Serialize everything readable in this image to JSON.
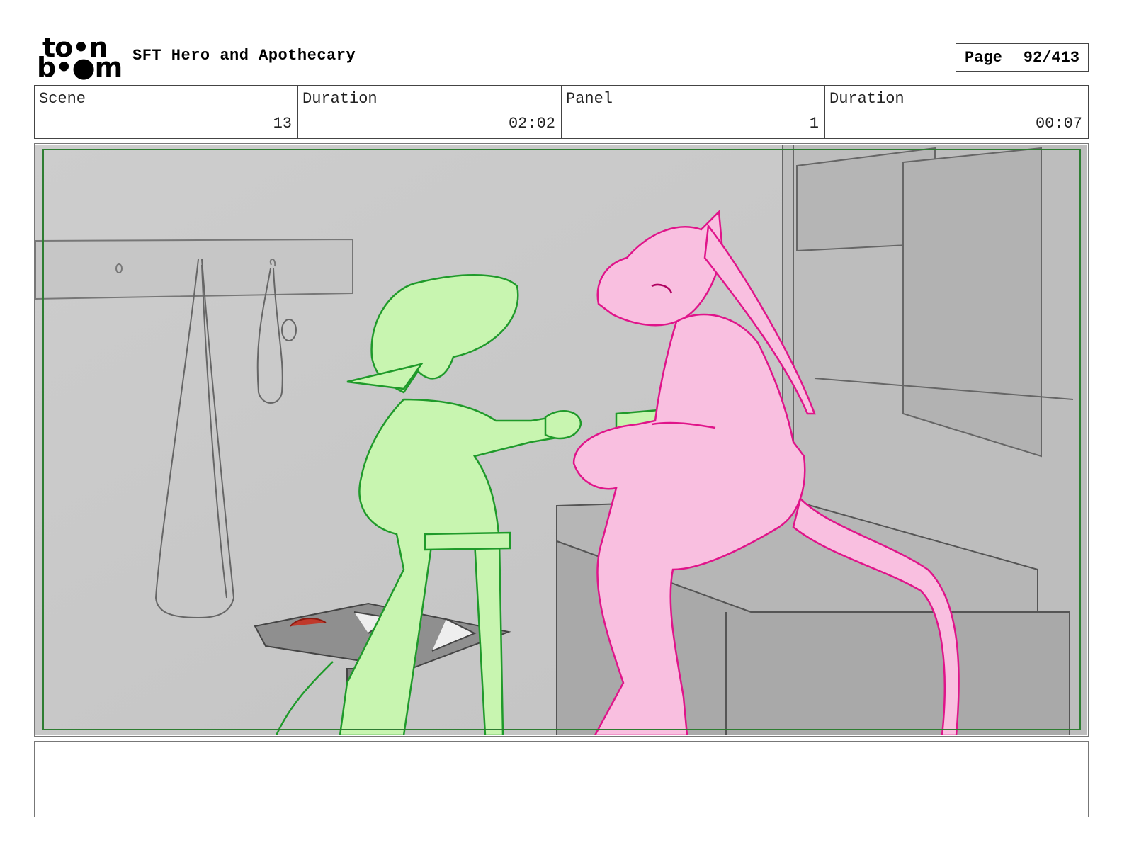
{
  "header": {
    "logo_line1": "to•n",
    "logo_line2": "b•●m",
    "title": "SFT Hero and Apothecary",
    "page_label": "Page",
    "page_number": "92/413"
  },
  "info": {
    "scene_label": "Scene",
    "scene_value": "13",
    "scene_duration_label": "Duration",
    "scene_duration_value": "02:02",
    "panel_label": "Panel",
    "panel_value": "1",
    "panel_duration_label": "Duration",
    "panel_duration_value": "00:07"
  },
  "panel": {
    "background_color": "#c9c9c9",
    "green_character_color": "#c8f5b0",
    "green_line_color": "#1f9a2a",
    "pink_character_color": "#f9bfe0",
    "pink_line_color": "#e0148a",
    "safe_area_color": "#2e7d32"
  },
  "notes": {
    "text": ""
  }
}
